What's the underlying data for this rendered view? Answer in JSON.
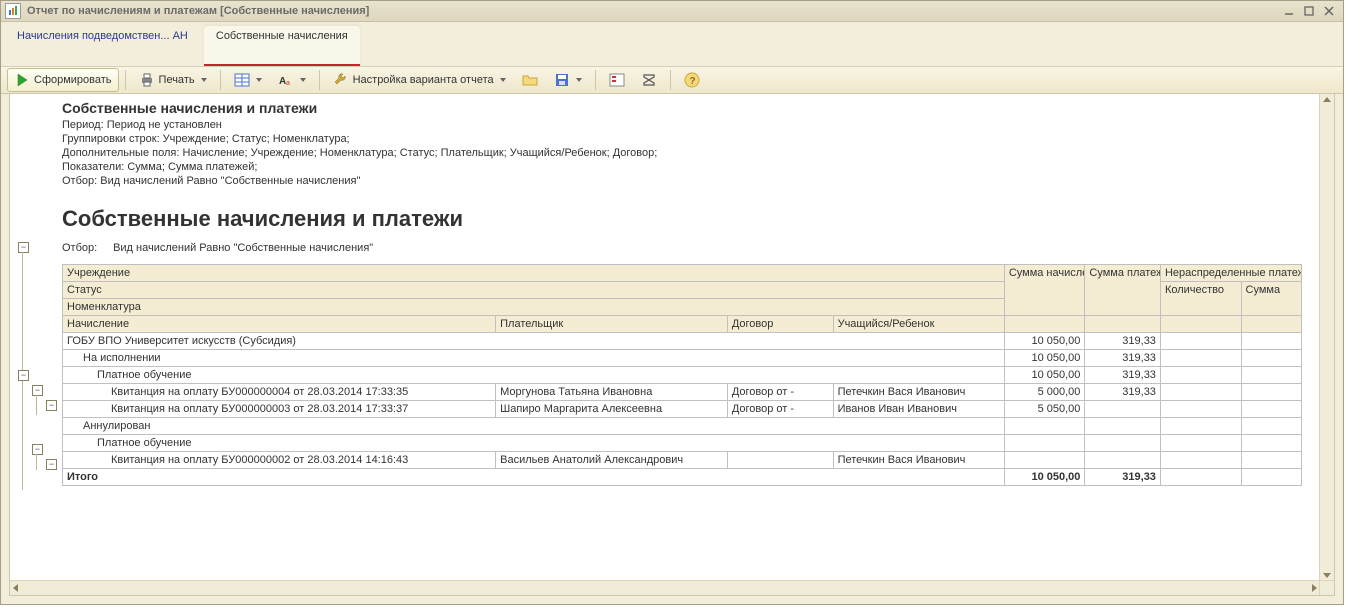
{
  "window": {
    "title": "Отчет по начислениям и платежам [Собственные начисления]"
  },
  "tabs": {
    "inactive": "Начисления подведомствен... АН",
    "active": "Собственные начисления"
  },
  "toolbar": {
    "generate": "Сформировать",
    "print": "Печать",
    "settings": "Настройка варианта отчета"
  },
  "header": {
    "title_small": "Собственные начисления и платежи",
    "period": "Период: Период не установлен",
    "grouping": "Группировки строк: Учреждение; Статус; Номенклатура;",
    "extra": "Дополнительные поля: Начисление; Учреждение; Номенклатура; Статус; Плательщик; Учащийся/Ребенок; Договор;",
    "measures": "Показатели: Сумма; Сумма платежей;",
    "filter_line": "Отбор: Вид начислений Равно \"Собственные начисления\"",
    "title_big": "Собственные начисления и платежи"
  },
  "filter": {
    "label": "Отбор:",
    "value": "Вид начислений Равно \"Собственные начисления\""
  },
  "columns": {
    "institution": "Учреждение",
    "status": "Статус",
    "nomenclature": "Номенклатура",
    "accrual": "Начисление",
    "payer": "Плательщик",
    "contract": "Договор",
    "student": "Учащийся/Ребенок",
    "sum_accr": "Сумма начислений",
    "sum_pay": "Сумма платежей",
    "undistributed": "Нераспределенные платежи",
    "qty": "Количество",
    "sum": "Сумма"
  },
  "rows": {
    "r1": {
      "name": "ГОБУ ВПО Университет искусств (Субсидия)",
      "sum_accr": "10 050,00",
      "sum_pay": "319,33"
    },
    "r2": {
      "name": "На исполнении",
      "sum_accr": "10 050,00",
      "sum_pay": "319,33"
    },
    "r3": {
      "name": "Платное обучение",
      "sum_accr": "10 050,00",
      "sum_pay": "319,33"
    },
    "r4": {
      "name": "Квитанция на оплату БУ000000004 от 28.03.2014 17:33:35",
      "payer": "Моргунова Татьяна Ивановна",
      "contract": "Договор  от  -",
      "student": "Петечкин Вася Иванович",
      "sum_accr": "5 000,00",
      "sum_pay": "319,33"
    },
    "r5": {
      "name": "Квитанция на оплату БУ000000003 от 28.03.2014 17:33:37",
      "payer": "Шапиро Маргарита Алексеевна",
      "contract": "Договор  от  -",
      "student": "Иванов Иван Иванович",
      "sum_accr": "5 050,00",
      "sum_pay": ""
    },
    "r6": {
      "name": "Аннулирован"
    },
    "r7": {
      "name": "Платное обучение"
    },
    "r8": {
      "name": "Квитанция на оплату БУ000000002 от 28.03.2014 14:16:43",
      "payer": "Васильев Анатолий Александрович",
      "contract": "",
      "student": "Петечкин Вася Иванович"
    },
    "total": {
      "label": "Итого",
      "sum_accr": "10 050,00",
      "sum_pay": "319,33"
    }
  }
}
